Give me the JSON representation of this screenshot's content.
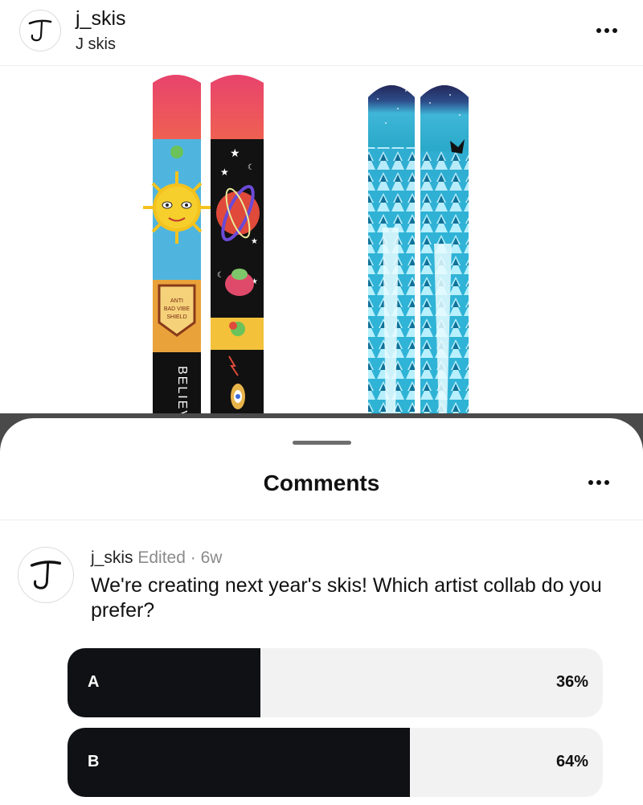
{
  "post": {
    "username": "j_skis",
    "display_name": "J skis"
  },
  "sheet": {
    "title": "Comments"
  },
  "comment": {
    "username": "j_skis",
    "edited": "Edited",
    "separator": "·",
    "time": "6w",
    "text": "We're creating next year's skis! Which artist collab do you prefer?"
  },
  "poll": {
    "options": [
      {
        "label": "A",
        "percent_text": "36%",
        "fraction": 0.36
      },
      {
        "label": "B",
        "percent_text": "64%",
        "fraction": 0.64
      }
    ]
  },
  "image": {
    "ski_left_tip_text": "ANTI BAD VIBE SHIELD",
    "ski_left_tail_text": "BELIEVE"
  },
  "icons": {
    "more": "more-horizontal-icon",
    "avatar": "j-logo-icon"
  }
}
